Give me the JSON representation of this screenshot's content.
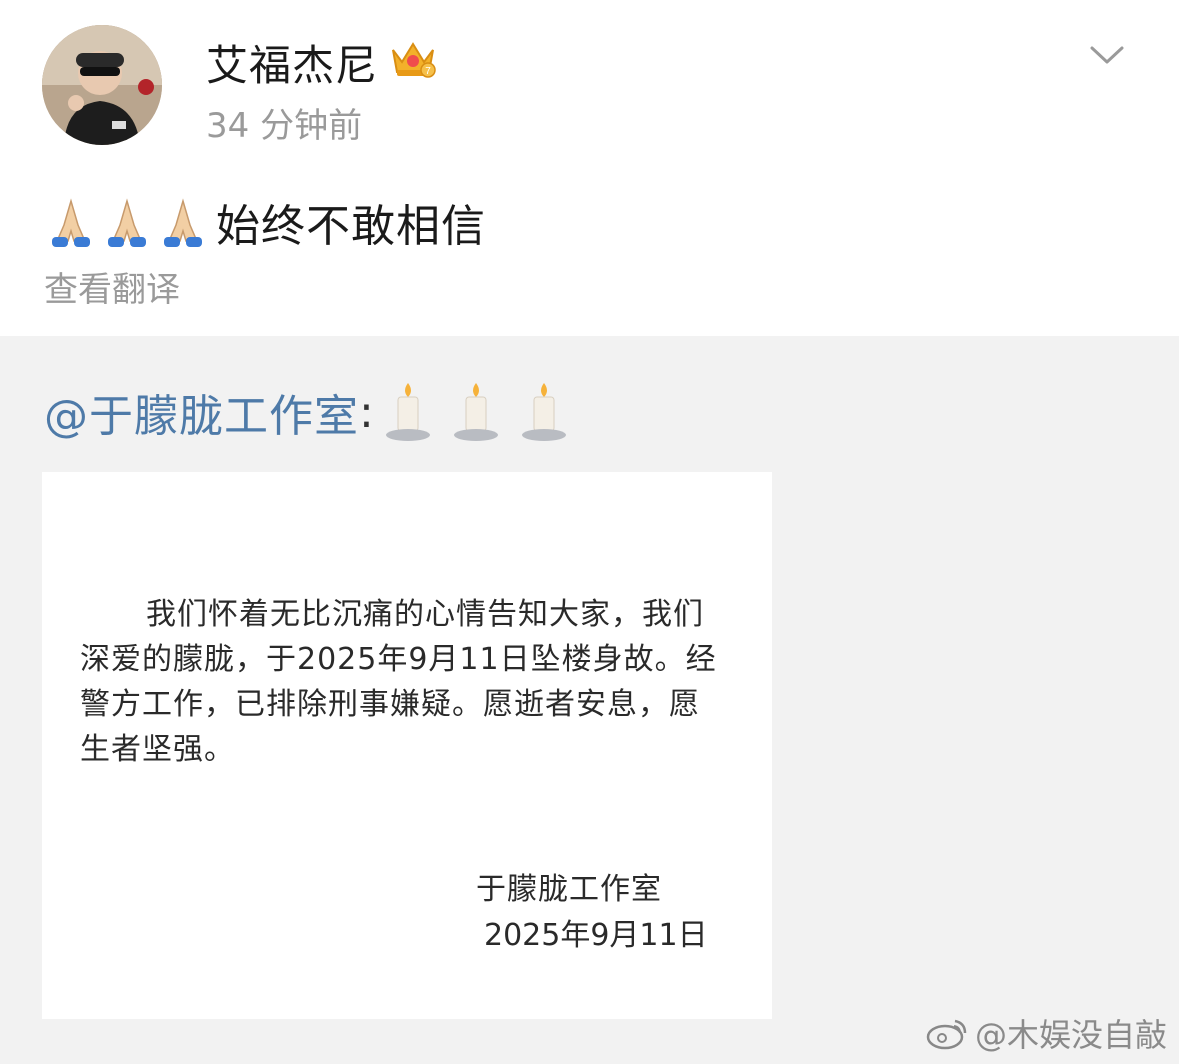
{
  "author": {
    "name": "艾福杰尼",
    "time": "34 分钟前",
    "badge_icon": "crown-badge-icon"
  },
  "post": {
    "emoji_icon": "praying-hands-emoji-icon",
    "emoji_count": 3,
    "text": "始终不敢相信",
    "translate_label": "查看翻译"
  },
  "repost": {
    "mention": "@于朦胧工作室",
    "colon": ":",
    "candle_icon": "candle-emoji-icon",
    "candle_count": 3,
    "notice": {
      "body": "我们怀着无比沉痛的心情告知大家，我们深爱的朦胧，于2025年9月11日坠楼身故。经警方工作，已排除刑事嫌疑。愿逝者安息，愿生者坚强。",
      "signer": "于朦胧工作室",
      "date": "2025年9月11日"
    }
  },
  "watermark": {
    "text": "@木娱没自敲",
    "icon": "weibo-logo-icon"
  },
  "colors": {
    "mention_blue": "#4e7aa8",
    "secondary_gray": "#9a9a9a",
    "repost_bg": "#f2f2f2"
  }
}
